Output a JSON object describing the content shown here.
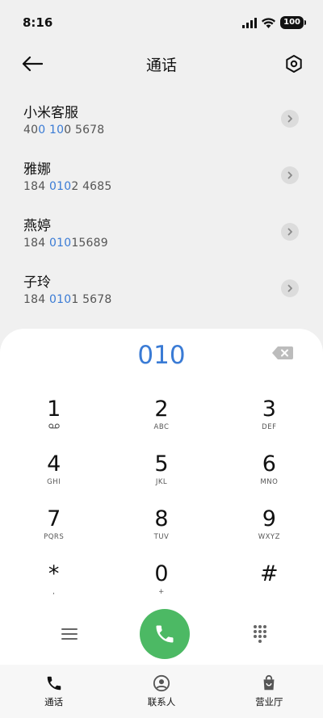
{
  "status_bar": {
    "time": "8:16",
    "battery": "100"
  },
  "header": {
    "title": "通话"
  },
  "results": [
    {
      "name": "小米客服",
      "number_parts": [
        {
          "t": "40",
          "hl": false
        },
        {
          "t": "0",
          "hl": true
        },
        {
          "t": " ",
          "hl": false
        },
        {
          "t": "10",
          "hl": true
        },
        {
          "t": "0 5678",
          "hl": false
        }
      ]
    },
    {
      "name": "雅娜",
      "number_parts": [
        {
          "t": "184 ",
          "hl": false
        },
        {
          "t": "010",
          "hl": true
        },
        {
          "t": "2 4685",
          "hl": false
        }
      ]
    },
    {
      "name": "燕婷",
      "number_parts": [
        {
          "t": "184 ",
          "hl": false
        },
        {
          "t": "010",
          "hl": true
        },
        {
          "t": "15689",
          "hl": false
        }
      ]
    },
    {
      "name": "子玲",
      "number_parts": [
        {
          "t": "184 ",
          "hl": false
        },
        {
          "t": "010",
          "hl": true
        },
        {
          "t": "1 5678",
          "hl": false
        }
      ]
    }
  ],
  "dialer": {
    "input": "010",
    "keys": [
      {
        "digit": "1",
        "letters": "",
        "voicemail": true
      },
      {
        "digit": "2",
        "letters": "ABC"
      },
      {
        "digit": "3",
        "letters": "DEF"
      },
      {
        "digit": "4",
        "letters": "GHI"
      },
      {
        "digit": "5",
        "letters": "JKL"
      },
      {
        "digit": "6",
        "letters": "MNO"
      },
      {
        "digit": "7",
        "letters": "PQRS"
      },
      {
        "digit": "8",
        "letters": "TUV"
      },
      {
        "digit": "9",
        "letters": "WXYZ"
      },
      {
        "digit": "*",
        "letters": ","
      },
      {
        "digit": "0",
        "letters": "+"
      },
      {
        "digit": "#",
        "letters": ""
      }
    ]
  },
  "bottom_nav": [
    {
      "label": "通话",
      "icon": "phone-icon",
      "active": true
    },
    {
      "label": "联系人",
      "icon": "contacts-icon",
      "active": false
    },
    {
      "label": "营业厅",
      "icon": "shopping-bag-icon",
      "active": false
    }
  ],
  "colors": {
    "accent": "#3a7bd5",
    "call_green": "#4cb964"
  }
}
